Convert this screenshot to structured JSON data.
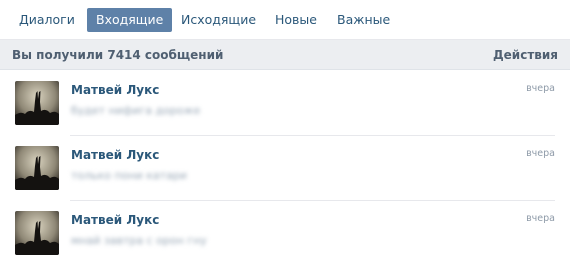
{
  "tabs": [
    {
      "label": "Диалоги"
    },
    {
      "label": "Входящие"
    },
    {
      "label": "Исходящие"
    },
    {
      "label": "Новые"
    },
    {
      "label": "Важные"
    }
  ],
  "summary": {
    "title": "Вы получили 7414 сообщений",
    "actions_label": "Действия"
  },
  "messages": [
    {
      "sender": "Матвей Лукс",
      "time": "вчера",
      "preview": "будет нифигa дороже"
    },
    {
      "sender": "Матвей Лукс",
      "time": "вчера",
      "preview": "только пони катари"
    },
    {
      "sender": "Матвей Лукс",
      "time": "вчера",
      "preview": "мнай завтра с орон гну"
    }
  ],
  "colors": {
    "accent": "#5e81a8",
    "link": "#2b587a",
    "summary_bg": "#eceef1"
  },
  "icons": {
    "avatar": "concert-crowd-photo"
  }
}
